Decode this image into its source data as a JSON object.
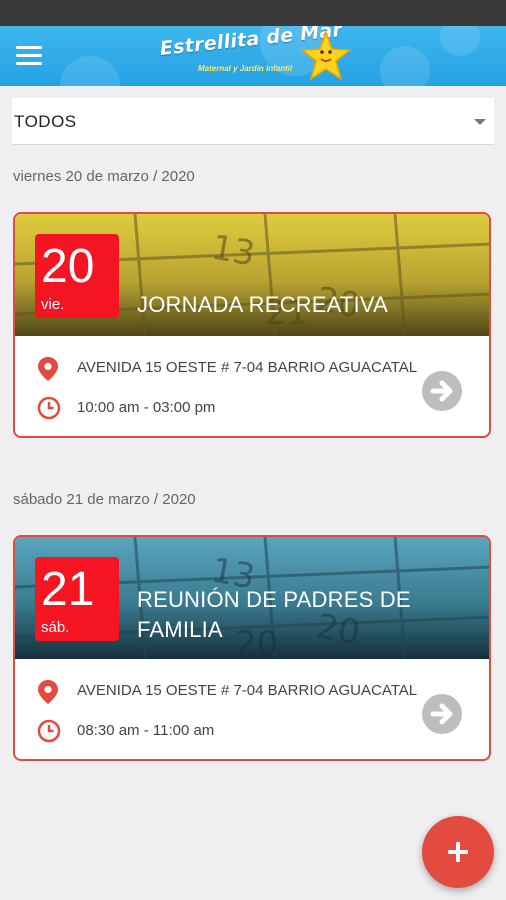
{
  "header": {
    "logo_title": "Estrellita de Mar",
    "logo_subtitle": "Maternal y Jardín Infantil",
    "brand_color": "#23a2e4"
  },
  "filter": {
    "selected": "TODOS"
  },
  "accent_color": "#e34b3f",
  "events": [
    {
      "date_heading": "viernes 20 de marzo / 2020",
      "day_number": "20",
      "day_abbr": "vie.",
      "title": "JORNADA RECREATIVA",
      "location": "AVENIDA 15 OESTE # 7-04 BARRIO AGUACATAL",
      "time": "10:00 am - 03:00 pm",
      "banner_color": "#c9b43a"
    },
    {
      "date_heading": "sábado 21 de marzo / 2020",
      "day_number": "21",
      "day_abbr": "sáb.",
      "title": "REUNIÓN DE PADRES DE FAMILIA",
      "location": "AVENIDA 15 OESTE # 7-04 BARRIO AGUACATAL",
      "time": "08:30 am - 11:00 am",
      "banner_color": "#3f7f94"
    }
  ],
  "icons": {
    "menu": "menu-icon",
    "location": "location-pin-icon",
    "time": "clock-icon",
    "go": "arrow-right-circle-icon",
    "add": "plus-icon"
  }
}
